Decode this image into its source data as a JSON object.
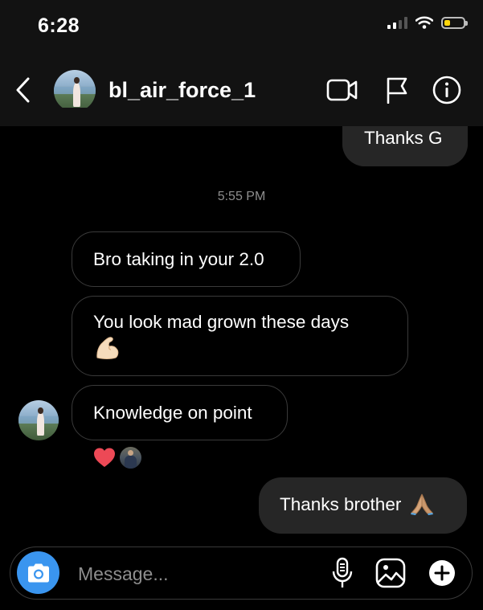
{
  "status_bar": {
    "time": "6:28"
  },
  "header": {
    "username": "bl_air_force_1"
  },
  "messages": [
    {
      "direction": "outgoing",
      "text": "Thanks G"
    },
    {
      "direction": "incoming",
      "text": "Bro taking in your 2.0"
    },
    {
      "direction": "incoming",
      "text": "You look mad grown these days",
      "emoji": "flexed-biceps"
    },
    {
      "direction": "incoming",
      "text": "Knowledge on point",
      "reactions": [
        "red-heart",
        "reactor-avatar"
      ]
    },
    {
      "direction": "outgoing",
      "text": "Thanks brother",
      "emoji": "folded-hands"
    }
  ],
  "timestamp": "5:55 PM",
  "composer": {
    "placeholder": "Message..."
  },
  "colors": {
    "background": "#000000",
    "header_background": "#121212",
    "outgoing_bubble": "#262626",
    "incoming_border": "#3a3a3a",
    "camera_button": "#3a95ef",
    "heart": "#ed4956",
    "battery_level": "#ffd60a"
  }
}
